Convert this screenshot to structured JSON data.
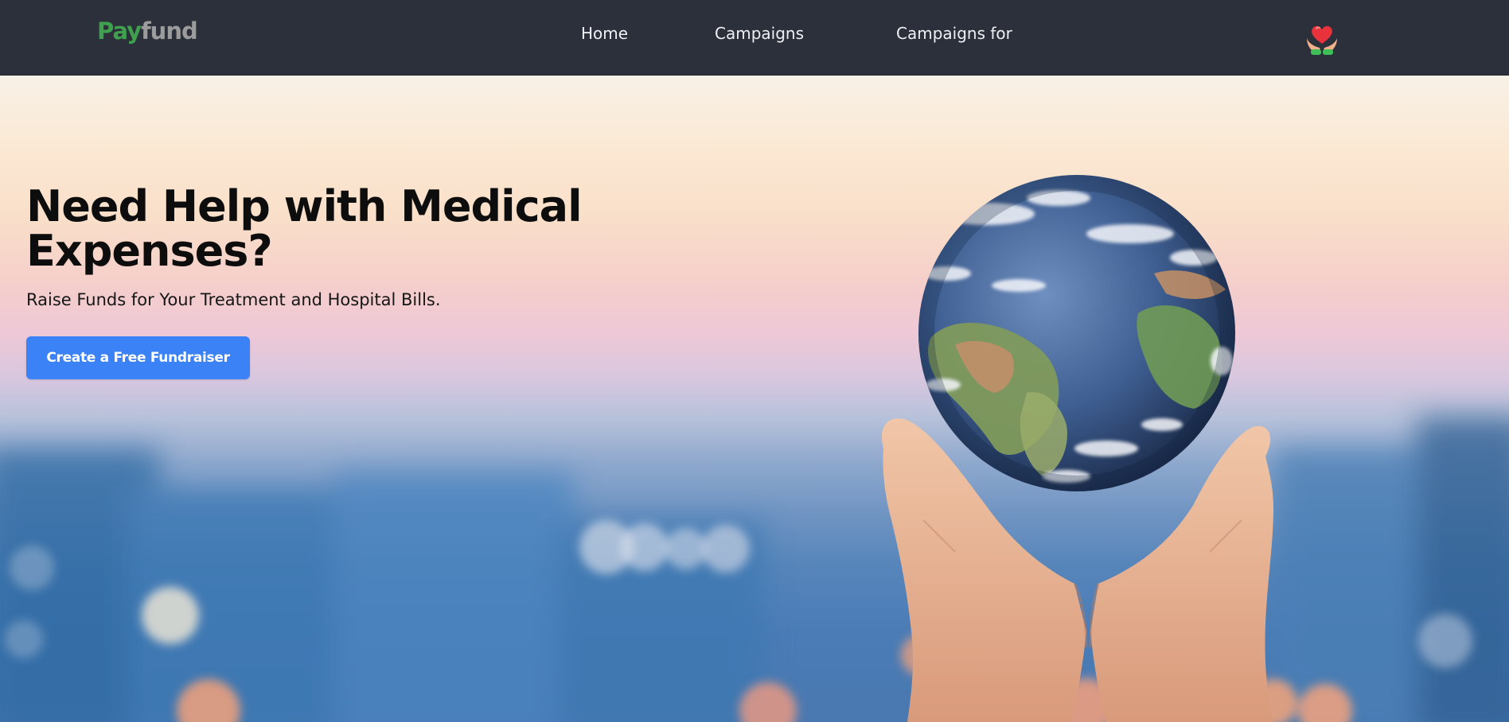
{
  "navbar": {
    "brand_part1": "Pay",
    "brand_part2": "fund",
    "links": [
      {
        "label": "Home"
      },
      {
        "label": "Campaigns"
      },
      {
        "label": "Campaigns for"
      }
    ],
    "logo_icon": "heart-in-hands-icon"
  },
  "hero": {
    "title": "Need Help with Medical Expenses?",
    "subtitle": "Raise Funds for Your Treatment and Hospital Bills.",
    "cta_label": "Create a Free Fundraiser",
    "image": "hands-holding-earth-globe"
  },
  "colors": {
    "navbar_bg": "#2b303a",
    "brand_green": "#3fa04d",
    "brand_gray": "#9c9c9c",
    "cta_blue": "#3b82f6",
    "title_text": "#0d0d0d"
  }
}
